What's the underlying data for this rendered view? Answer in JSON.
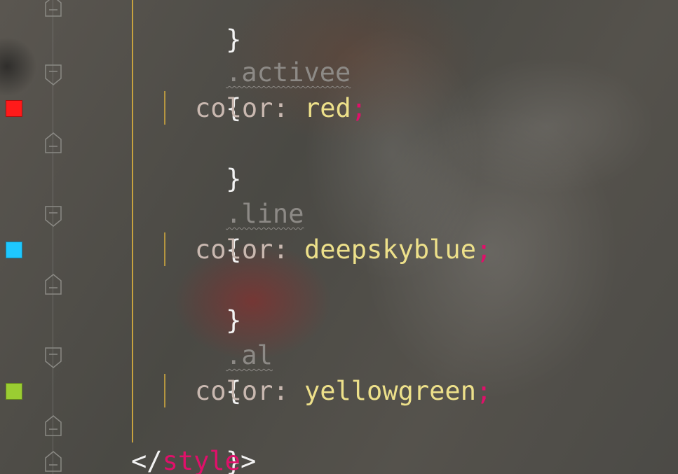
{
  "editor": {
    "lines": [
      {
        "kind": "brace",
        "text": "}"
      },
      {
        "kind": "selector",
        "text": ".activee"
      },
      {
        "kind": "brace",
        "text": "{"
      },
      {
        "kind": "decl",
        "prop": "color",
        "colon": ": ",
        "value": "red",
        "semi": ";",
        "swatch": "#ff1a1a"
      },
      {
        "kind": "brace",
        "text": "}"
      },
      {
        "kind": "selector",
        "text": ".line"
      },
      {
        "kind": "brace",
        "text": "{"
      },
      {
        "kind": "decl",
        "prop": "color",
        "colon": ": ",
        "value": "deepskyblue",
        "semi": ";",
        "swatch": "#1ec8ff"
      },
      {
        "kind": "brace",
        "text": "}"
      },
      {
        "kind": "selector",
        "text": ".al"
      },
      {
        "kind": "brace",
        "text": "{"
      },
      {
        "kind": "decl",
        "prop": "color",
        "colon": ": ",
        "value": "yellowgreen",
        "semi": ";",
        "swatch": "#9acd32"
      },
      {
        "kind": "brace",
        "text": "}"
      }
    ],
    "closing_tag": {
      "open": "</",
      "name": "style",
      "close": ">"
    }
  },
  "colors": {
    "brace": "#f2f2f2",
    "selector": "#8d8a86",
    "property": "#c9b8b0",
    "value": "#ede08a",
    "punctuation": "#e0106a",
    "indent_guide": "#c7a23f"
  }
}
